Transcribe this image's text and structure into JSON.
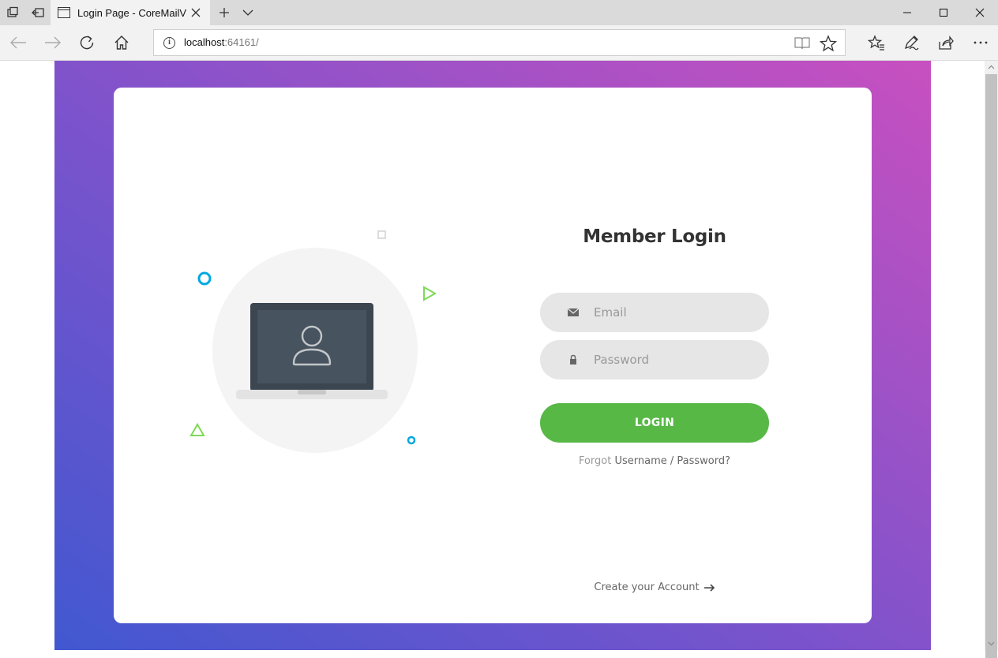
{
  "browser": {
    "tab_title": "Login Page - CoreMailV",
    "address_host": "localhost",
    "address_port": ":64161/"
  },
  "login": {
    "title": "Member Login",
    "email_placeholder": "Email",
    "password_placeholder": "Password",
    "button_label": "LOGIN",
    "forgot_prefix": "Forgot",
    "forgot_link": "Username / Password?",
    "create_account": "Create your Account"
  },
  "colors": {
    "gradient_start": "#4158d0",
    "gradient_end": "#c850c0",
    "login_button": "#57b846",
    "accent_blue": "#00a8e0",
    "accent_green": "#7ed957"
  },
  "icons": [
    "tab-set-aside-icon",
    "tab-preview-icon",
    "page-icon",
    "close-icon",
    "new-tab-icon",
    "chevron-down-icon",
    "minimize-icon",
    "maximize-icon",
    "back-arrow-icon",
    "forward-arrow-icon",
    "refresh-icon",
    "home-icon",
    "info-icon",
    "reading-view-icon",
    "star-icon",
    "favorites-icon",
    "pen-icon",
    "share-icon",
    "more-icon",
    "envelope-icon",
    "lock-icon",
    "user-icon",
    "arrow-right-icon"
  ]
}
